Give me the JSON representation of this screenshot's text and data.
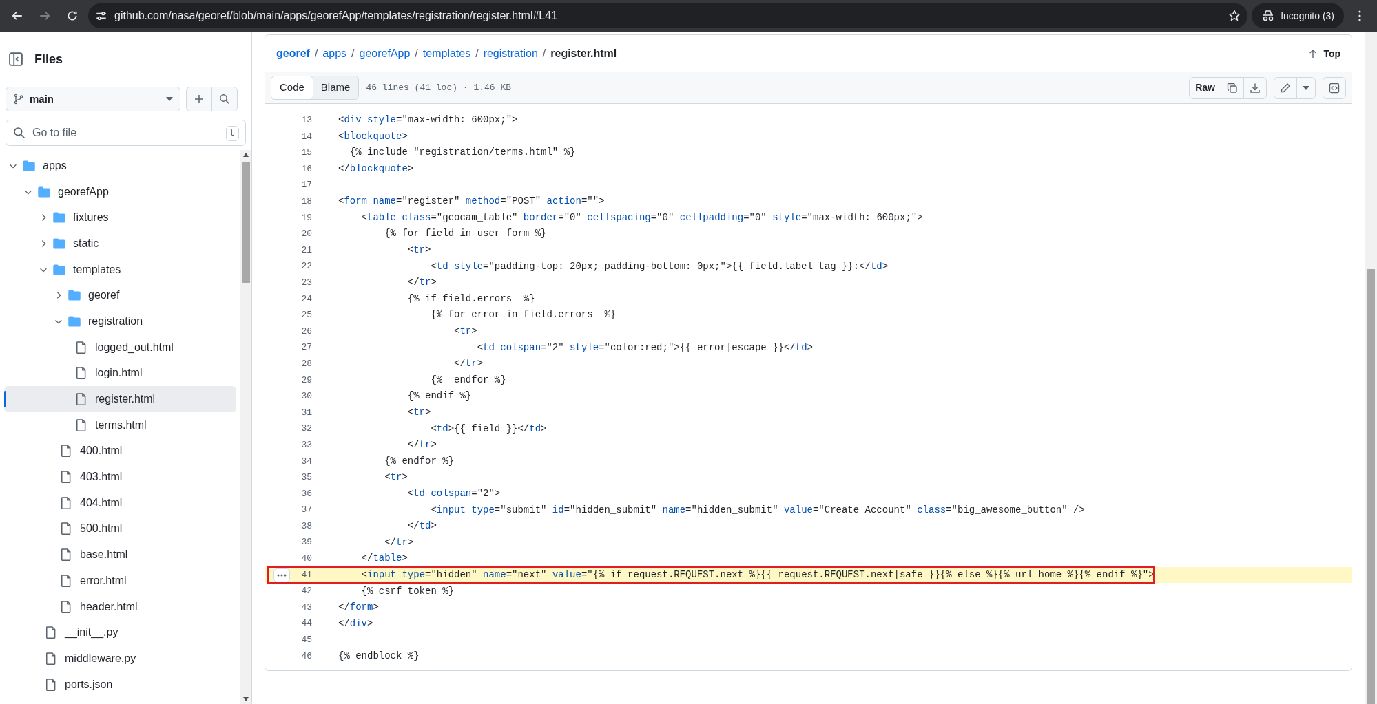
{
  "browser": {
    "url": "github.com/nasa/georef/blob/main/apps/georefApp/templates/registration/register.html#L41",
    "profile": "Incognito (3)"
  },
  "sidebar": {
    "title": "Files",
    "branch": "main",
    "search": {
      "placeholder": "Go to file",
      "shortcut": "t"
    },
    "tree": [
      {
        "kind": "folder",
        "name": "apps",
        "expanded": true,
        "selected": false,
        "children": [
          {
            "kind": "folder",
            "name": "georefApp",
            "expanded": true,
            "selected": false,
            "children": [
              {
                "kind": "folder",
                "name": "fixtures",
                "expanded": false,
                "selected": false
              },
              {
                "kind": "folder",
                "name": "static",
                "expanded": false,
                "selected": false
              },
              {
                "kind": "folder",
                "name": "templates",
                "expanded": true,
                "selected": false,
                "children": [
                  {
                    "kind": "folder",
                    "name": "georef",
                    "expanded": false,
                    "selected": false
                  },
                  {
                    "kind": "folder",
                    "name": "registration",
                    "expanded": true,
                    "selected": false,
                    "children": [
                      {
                        "kind": "file",
                        "name": "logged_out.html",
                        "selected": false
                      },
                      {
                        "kind": "file",
                        "name": "login.html",
                        "selected": false
                      },
                      {
                        "kind": "file",
                        "name": "register.html",
                        "selected": true
                      },
                      {
                        "kind": "file",
                        "name": "terms.html",
                        "selected": false
                      }
                    ]
                  },
                  {
                    "kind": "file",
                    "name": "400.html",
                    "selected": false
                  },
                  {
                    "kind": "file",
                    "name": "403.html",
                    "selected": false
                  },
                  {
                    "kind": "file",
                    "name": "404.html",
                    "selected": false
                  },
                  {
                    "kind": "file",
                    "name": "500.html",
                    "selected": false
                  },
                  {
                    "kind": "file",
                    "name": "base.html",
                    "selected": false
                  },
                  {
                    "kind": "file",
                    "name": "error.html",
                    "selected": false
                  },
                  {
                    "kind": "file",
                    "name": "header.html",
                    "selected": false
                  }
                ]
              },
              {
                "kind": "file",
                "name": "__init__.py",
                "selected": false
              },
              {
                "kind": "file",
                "name": "middleware.py",
                "selected": false
              },
              {
                "kind": "file",
                "name": "ports.json",
                "selected": false
              }
            ]
          }
        ]
      }
    ]
  },
  "breadcrumb": {
    "links": [
      "georef",
      "apps",
      "georefApp",
      "templates",
      "registration"
    ],
    "separator": "/",
    "current": "register.html",
    "top_link": "Top"
  },
  "toolbar": {
    "tabs": [
      {
        "label": "Code",
        "selected": true
      },
      {
        "label": "Blame",
        "selected": false
      }
    ],
    "file_info": "46 lines (41 loc) · 1.46 KB",
    "raw_button": "Raw"
  },
  "code": {
    "lines": [
      {
        "number": "13",
        "selected": false,
        "marked": false,
        "segments": [
          {
            "kind": "plain",
            "text": "<"
          },
          {
            "kind": "name",
            "text": "div style"
          },
          {
            "kind": "plain",
            "text": "=\"max-width: 600px;\">"
          }
        ]
      },
      {
        "number": "14",
        "selected": false,
        "marked": false,
        "segments": [
          {
            "kind": "plain",
            "text": "<"
          },
          {
            "kind": "name",
            "text": "blockquote"
          },
          {
            "kind": "plain",
            "text": ">"
          }
        ]
      },
      {
        "number": "15",
        "selected": false,
        "marked": false,
        "segments": [
          {
            "kind": "plain",
            "text": "  {% include \"registration/terms.html\" %}"
          }
        ]
      },
      {
        "number": "16",
        "selected": false,
        "marked": false,
        "segments": [
          {
            "kind": "plain",
            "text": "</"
          },
          {
            "kind": "name",
            "text": "blockquote"
          },
          {
            "kind": "plain",
            "text": ">"
          }
        ]
      },
      {
        "number": "17",
        "selected": false,
        "marked": false
      },
      {
        "number": "18",
        "selected": false,
        "marked": false,
        "segments": [
          {
            "kind": "plain",
            "text": "<"
          },
          {
            "kind": "name",
            "text": "form name"
          },
          {
            "kind": "plain",
            "text": "=\"register\" "
          },
          {
            "kind": "name",
            "text": "method"
          },
          {
            "kind": "plain",
            "text": "=\"POST\" "
          },
          {
            "kind": "name",
            "text": "action"
          },
          {
            "kind": "plain",
            "text": "=\"\">"
          }
        ]
      },
      {
        "number": "19",
        "selected": false,
        "marked": false,
        "segments": [
          {
            "kind": "plain",
            "text": "    <"
          },
          {
            "kind": "name",
            "text": "table class"
          },
          {
            "kind": "plain",
            "text": "=\"geocam_table\" "
          },
          {
            "kind": "name",
            "text": "border"
          },
          {
            "kind": "plain",
            "text": "=\"0\" "
          },
          {
            "kind": "name",
            "text": "cellspacing"
          },
          {
            "kind": "plain",
            "text": "=\"0\" "
          },
          {
            "kind": "name",
            "text": "cellpadding"
          },
          {
            "kind": "plain",
            "text": "=\"0\" "
          },
          {
            "kind": "name",
            "text": "style"
          },
          {
            "kind": "plain",
            "text": "=\"max-width: 600px;\">"
          }
        ]
      },
      {
        "number": "20",
        "selected": false,
        "marked": false,
        "segments": [
          {
            "kind": "plain",
            "text": "        {% for field in user_form %}"
          }
        ]
      },
      {
        "number": "21",
        "selected": false,
        "marked": false,
        "segments": [
          {
            "kind": "plain",
            "text": "            <"
          },
          {
            "kind": "name",
            "text": "tr"
          },
          {
            "kind": "plain",
            "text": ">"
          }
        ]
      },
      {
        "number": "22",
        "selected": false,
        "marked": false,
        "segments": [
          {
            "kind": "plain",
            "text": "                <"
          },
          {
            "kind": "name",
            "text": "td style"
          },
          {
            "kind": "plain",
            "text": "=\"padding-top: 20px; padding-bottom: 0px;\">{{ field.label_tag }}:</"
          },
          {
            "kind": "name",
            "text": "td"
          },
          {
            "kind": "plain",
            "text": ">"
          }
        ]
      },
      {
        "number": "23",
        "selected": false,
        "marked": false,
        "segments": [
          {
            "kind": "plain",
            "text": "            </"
          },
          {
            "kind": "name",
            "text": "tr"
          },
          {
            "kind": "plain",
            "text": ">"
          }
        ]
      },
      {
        "number": "24",
        "selected": false,
        "marked": false,
        "segments": [
          {
            "kind": "plain",
            "text": "            {% if field.errors  %}"
          }
        ]
      },
      {
        "number": "25",
        "selected": false,
        "marked": false,
        "segments": [
          {
            "kind": "plain",
            "text": "                {% for error in field.errors  %}"
          }
        ]
      },
      {
        "number": "26",
        "selected": false,
        "marked": false,
        "segments": [
          {
            "kind": "plain",
            "text": "                    <"
          },
          {
            "kind": "name",
            "text": "tr"
          },
          {
            "kind": "plain",
            "text": ">"
          }
        ]
      },
      {
        "number": "27",
        "selected": false,
        "marked": false,
        "segments": [
          {
            "kind": "plain",
            "text": "                        <"
          },
          {
            "kind": "name",
            "text": "td colspan"
          },
          {
            "kind": "plain",
            "text": "=\"2\" "
          },
          {
            "kind": "name",
            "text": "style"
          },
          {
            "kind": "plain",
            "text": "=\"color:red;\">{{ error|escape }}</"
          },
          {
            "kind": "name",
            "text": "td"
          },
          {
            "kind": "plain",
            "text": ">"
          }
        ]
      },
      {
        "number": "28",
        "selected": false,
        "marked": false,
        "segments": [
          {
            "kind": "plain",
            "text": "                    </"
          },
          {
            "kind": "name",
            "text": "tr"
          },
          {
            "kind": "plain",
            "text": ">"
          }
        ]
      },
      {
        "number": "29",
        "selected": false,
        "marked": false,
        "segments": [
          {
            "kind": "plain",
            "text": "                {%  endfor %}"
          }
        ]
      },
      {
        "number": "30",
        "selected": false,
        "marked": false,
        "segments": [
          {
            "kind": "plain",
            "text": "            {% endif %}"
          }
        ]
      },
      {
        "number": "31",
        "selected": false,
        "marked": false,
        "segments": [
          {
            "kind": "plain",
            "text": "            <"
          },
          {
            "kind": "name",
            "text": "tr"
          },
          {
            "kind": "plain",
            "text": ">"
          }
        ]
      },
      {
        "number": "32",
        "selected": false,
        "marked": false,
        "segments": [
          {
            "kind": "plain",
            "text": "                <"
          },
          {
            "kind": "name",
            "text": "td"
          },
          {
            "kind": "plain",
            "text": ">{{ field }}</"
          },
          {
            "kind": "name",
            "text": "td"
          },
          {
            "kind": "plain",
            "text": ">"
          }
        ]
      },
      {
        "number": "33",
        "selected": false,
        "marked": false,
        "segments": [
          {
            "kind": "plain",
            "text": "            </"
          },
          {
            "kind": "name",
            "text": "tr"
          },
          {
            "kind": "plain",
            "text": ">"
          }
        ]
      },
      {
        "number": "34",
        "selected": false,
        "marked": false,
        "segments": [
          {
            "kind": "plain",
            "text": "        {% endfor %}"
          }
        ]
      },
      {
        "number": "35",
        "selected": false,
        "marked": false,
        "segments": [
          {
            "kind": "plain",
            "text": "        <"
          },
          {
            "kind": "name",
            "text": "tr"
          },
          {
            "kind": "plain",
            "text": ">"
          }
        ]
      },
      {
        "number": "36",
        "selected": false,
        "marked": false,
        "segments": [
          {
            "kind": "plain",
            "text": "            <"
          },
          {
            "kind": "name",
            "text": "td colspan"
          },
          {
            "kind": "plain",
            "text": "=\"2\">"
          }
        ]
      },
      {
        "number": "37",
        "selected": false,
        "marked": false,
        "segments": [
          {
            "kind": "plain",
            "text": "                <"
          },
          {
            "kind": "name",
            "text": "input type"
          },
          {
            "kind": "plain",
            "text": "=\"submit\" "
          },
          {
            "kind": "name",
            "text": "id"
          },
          {
            "kind": "plain",
            "text": "=\"hidden_submit\" "
          },
          {
            "kind": "name",
            "text": "name"
          },
          {
            "kind": "plain",
            "text": "=\"hidden_submit\" "
          },
          {
            "kind": "name",
            "text": "value"
          },
          {
            "kind": "plain",
            "text": "=\"Create Account\" "
          },
          {
            "kind": "name",
            "text": "class"
          },
          {
            "kind": "plain",
            "text": "=\"big_awesome_button\" />"
          }
        ]
      },
      {
        "number": "38",
        "selected": false,
        "marked": false,
        "segments": [
          {
            "kind": "plain",
            "text": "            </"
          },
          {
            "kind": "name",
            "text": "td"
          },
          {
            "kind": "plain",
            "text": ">"
          }
        ]
      },
      {
        "number": "39",
        "selected": false,
        "marked": false,
        "segments": [
          {
            "kind": "plain",
            "text": "        </"
          },
          {
            "kind": "name",
            "text": "tr"
          },
          {
            "kind": "plain",
            "text": ">"
          }
        ]
      },
      {
        "number": "40",
        "selected": false,
        "marked": false,
        "segments": [
          {
            "kind": "plain",
            "text": "    </"
          },
          {
            "kind": "name",
            "text": "table"
          },
          {
            "kind": "plain",
            "text": ">"
          }
        ]
      },
      {
        "number": "41",
        "selected": true,
        "marked": true,
        "segments": [
          {
            "kind": "plain",
            "text": "    <"
          },
          {
            "kind": "name",
            "text": "input type"
          },
          {
            "kind": "plain",
            "text": "=\"hidden\" "
          },
          {
            "kind": "name",
            "text": "name"
          },
          {
            "kind": "plain",
            "text": "=\"next\" "
          },
          {
            "kind": "name",
            "text": "value"
          },
          {
            "kind": "plain",
            "text": "=\"{% if request.REQUEST.next %}{{ request.REQUEST.next|safe }}{% else %}{% url home %}{% endif %}\">"
          }
        ]
      },
      {
        "number": "42",
        "selected": false,
        "marked": false,
        "segments": [
          {
            "kind": "plain",
            "text": "    {% csrf_token %}"
          }
        ]
      },
      {
        "number": "43",
        "selected": false,
        "marked": false,
        "segments": [
          {
            "kind": "plain",
            "text": "</"
          },
          {
            "kind": "name",
            "text": "form"
          },
          {
            "kind": "plain",
            "text": ">"
          }
        ]
      },
      {
        "number": "44",
        "selected": false,
        "marked": false,
        "segments": [
          {
            "kind": "plain",
            "text": "</"
          },
          {
            "kind": "name",
            "text": "div"
          },
          {
            "kind": "plain",
            "text": ">"
          }
        ]
      },
      {
        "number": "45",
        "selected": false,
        "marked": false
      },
      {
        "number": "46",
        "selected": false,
        "marked": false,
        "segments": [
          {
            "kind": "plain",
            "text": "{% endblock %}"
          }
        ]
      }
    ]
  }
}
